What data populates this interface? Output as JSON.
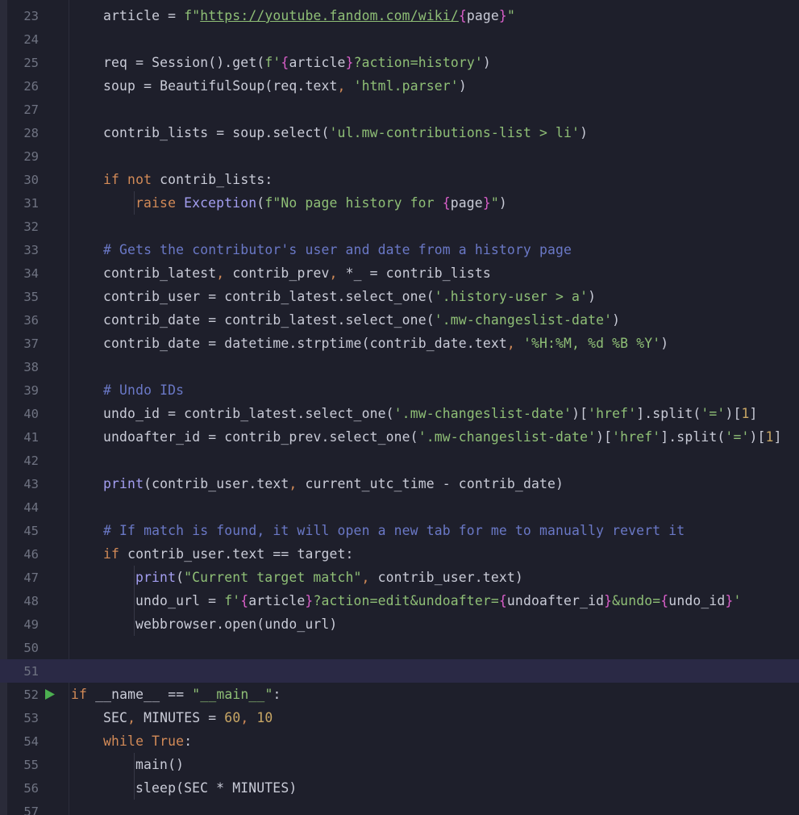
{
  "editor": {
    "lines": [
      {
        "n": "23",
        "indent": 1,
        "parts": [
          [
            "",
            "article = "
          ],
          [
            "str",
            "f\""
          ],
          [
            "url",
            "https://youtube.fandom.com/wiki/"
          ],
          [
            "br",
            "{"
          ],
          [
            "",
            "page"
          ],
          [
            "br",
            "}"
          ],
          [
            "str",
            "\""
          ]
        ]
      },
      {
        "n": "24",
        "indent": 1,
        "parts": []
      },
      {
        "n": "25",
        "indent": 1,
        "parts": [
          [
            "",
            "req = Session().get("
          ],
          [
            "str",
            "f'"
          ],
          [
            "br",
            "{"
          ],
          [
            "",
            "article"
          ],
          [
            "br",
            "}"
          ],
          [
            "str",
            "?action=history'"
          ],
          [
            "",
            ")"
          ]
        ]
      },
      {
        "n": "26",
        "indent": 1,
        "parts": [
          [
            "",
            "soup = BeautifulSoup(req.text"
          ],
          [
            "sep",
            ", "
          ],
          [
            "str",
            "'html.parser'"
          ],
          [
            "",
            ")"
          ]
        ]
      },
      {
        "n": "27",
        "indent": 1,
        "parts": []
      },
      {
        "n": "28",
        "indent": 1,
        "parts": [
          [
            "",
            "contrib_lists = soup.select("
          ],
          [
            "str",
            "'ul.mw-contributions-list > li'"
          ],
          [
            "",
            ")"
          ]
        ]
      },
      {
        "n": "29",
        "indent": 1,
        "parts": []
      },
      {
        "n": "30",
        "indent": 1,
        "parts": [
          [
            "kw",
            "if not "
          ],
          [
            "",
            "contrib_lists:"
          ]
        ]
      },
      {
        "n": "31",
        "indent": 2,
        "parts": [
          [
            "kw",
            "raise "
          ],
          [
            "fn",
            "Exception"
          ],
          [
            "",
            "("
          ],
          [
            "str",
            "f\"No page history for "
          ],
          [
            "br",
            "{"
          ],
          [
            "",
            "page"
          ],
          [
            "br",
            "}"
          ],
          [
            "str",
            "\""
          ],
          [
            "",
            ")"
          ]
        ]
      },
      {
        "n": "32",
        "indent": 1,
        "parts": []
      },
      {
        "n": "33",
        "indent": 1,
        "parts": [
          [
            "cm",
            "# Gets the contributor's user and date from a history page"
          ]
        ]
      },
      {
        "n": "34",
        "indent": 1,
        "parts": [
          [
            "",
            "contrib_latest"
          ],
          [
            "sep",
            ", "
          ],
          [
            "",
            "contrib_prev"
          ],
          [
            "sep",
            ", "
          ],
          [
            "",
            "*_ = contrib_lists"
          ]
        ]
      },
      {
        "n": "35",
        "indent": 1,
        "parts": [
          [
            "",
            "contrib_user = contrib_latest.select_one("
          ],
          [
            "str",
            "'.history-user > a'"
          ],
          [
            "",
            ")"
          ]
        ]
      },
      {
        "n": "36",
        "indent": 1,
        "parts": [
          [
            "",
            "contrib_date = contrib_latest.select_one("
          ],
          [
            "str",
            "'.mw-changeslist-date'"
          ],
          [
            "",
            ")"
          ]
        ]
      },
      {
        "n": "37",
        "indent": 1,
        "parts": [
          [
            "",
            "contrib_date = datetime.strptime(contrib_date.text"
          ],
          [
            "sep",
            ", "
          ],
          [
            "str",
            "'%H:%M, %d %B %Y'"
          ],
          [
            "",
            ")"
          ]
        ]
      },
      {
        "n": "38",
        "indent": 1,
        "parts": []
      },
      {
        "n": "39",
        "indent": 1,
        "parts": [
          [
            "cm",
            "# Undo IDs"
          ]
        ]
      },
      {
        "n": "40",
        "indent": 1,
        "parts": [
          [
            "",
            "undo_id = contrib_latest.select_one("
          ],
          [
            "str",
            "'.mw-changeslist-date'"
          ],
          [
            "",
            ")["
          ],
          [
            "str",
            "'href'"
          ],
          [
            "",
            "].split("
          ],
          [
            "str",
            "'='"
          ],
          [
            "",
            ")["
          ],
          [
            "num-lit",
            "1"
          ],
          [
            "",
            "]"
          ]
        ]
      },
      {
        "n": "41",
        "indent": 1,
        "parts": [
          [
            "",
            "undoafter_id = contrib_prev.select_one("
          ],
          [
            "str",
            "'.mw-changeslist-date'"
          ],
          [
            "",
            ")["
          ],
          [
            "str",
            "'href'"
          ],
          [
            "",
            "].split("
          ],
          [
            "str",
            "'='"
          ],
          [
            "",
            ")["
          ],
          [
            "num-lit",
            "1"
          ],
          [
            "",
            "]"
          ]
        ]
      },
      {
        "n": "42",
        "indent": 1,
        "parts": []
      },
      {
        "n": "43",
        "indent": 1,
        "parts": [
          [
            "fn",
            "print"
          ],
          [
            "",
            "(contrib_user.text"
          ],
          [
            "sep",
            ", "
          ],
          [
            "",
            "current_utc_time - contrib_date)"
          ]
        ]
      },
      {
        "n": "44",
        "indent": 1,
        "parts": []
      },
      {
        "n": "45",
        "indent": 1,
        "parts": [
          [
            "cm",
            "# If match is found, it will open a new tab for me to manually revert it"
          ]
        ]
      },
      {
        "n": "46",
        "indent": 1,
        "parts": [
          [
            "kw",
            "if "
          ],
          [
            "",
            "contrib_user.text == target:"
          ]
        ]
      },
      {
        "n": "47",
        "indent": 2,
        "parts": [
          [
            "fn",
            "print"
          ],
          [
            "",
            "("
          ],
          [
            "str",
            "\"Current target match\""
          ],
          [
            "sep",
            ", "
          ],
          [
            "",
            "contrib_user.text)"
          ]
        ]
      },
      {
        "n": "48",
        "indent": 2,
        "parts": [
          [
            "",
            "undo_url = "
          ],
          [
            "str",
            "f'"
          ],
          [
            "br",
            "{"
          ],
          [
            "",
            "article"
          ],
          [
            "br",
            "}"
          ],
          [
            "str",
            "?action=edit&undoafter="
          ],
          [
            "br",
            "{"
          ],
          [
            "",
            "undoafter_id"
          ],
          [
            "br",
            "}"
          ],
          [
            "str",
            "&undo="
          ],
          [
            "br",
            "{"
          ],
          [
            "",
            "undo_id"
          ],
          [
            "br",
            "}"
          ],
          [
            "str",
            "'"
          ]
        ]
      },
      {
        "n": "49",
        "indent": 2,
        "parts": [
          [
            "",
            "webbrowser.open(undo_url)"
          ]
        ]
      },
      {
        "n": "50",
        "indent": 0,
        "parts": []
      },
      {
        "n": "51",
        "indent": 0,
        "parts": [],
        "current": true
      },
      {
        "n": "52",
        "indent": 0,
        "parts": [
          [
            "kw",
            "if "
          ],
          [
            "",
            "__name__ == "
          ],
          [
            "str",
            "\"__main__\""
          ],
          [
            "",
            ":"
          ]
        ],
        "run": true
      },
      {
        "n": "53",
        "indent": 1,
        "parts": [
          [
            "",
            "SEC"
          ],
          [
            "sep",
            ", "
          ],
          [
            "",
            "MINUTES = "
          ],
          [
            "num-lit",
            "60"
          ],
          [
            "sep",
            ", "
          ],
          [
            "num-lit",
            "10"
          ]
        ]
      },
      {
        "n": "54",
        "indent": 1,
        "parts": [
          [
            "kw",
            "while True"
          ],
          [
            "",
            ":"
          ]
        ]
      },
      {
        "n": "55",
        "indent": 2,
        "parts": [
          [
            "",
            "main()"
          ]
        ]
      },
      {
        "n": "56",
        "indent": 2,
        "parts": [
          [
            "",
            "sleep(SEC * MINUTES)"
          ]
        ]
      },
      {
        "n": "57",
        "indent": 0,
        "parts": []
      }
    ]
  },
  "colors": {
    "background": "#1e1f2b",
    "current_line": "#2a2945",
    "keyword": "#d28a57",
    "string": "#8fbf76",
    "comment": "#6a78c6",
    "function": "#a39ef0",
    "number": "#c9a765",
    "brace": "#d95fc9",
    "run_icon": "#4caf50"
  },
  "icons": {
    "run": "run-triangle-icon"
  }
}
